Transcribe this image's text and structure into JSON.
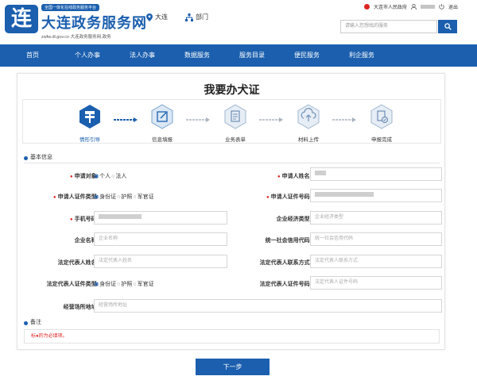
{
  "header": {
    "slogan": "全国一体化在线政务服务平台",
    "site_title": "大连政务服务网",
    "site_sub": "zwfw.dl.gov.cn  大连政务服务网.政务",
    "logo_char": "连",
    "location": "大连",
    "department": "部门",
    "gov_link": "大连市人民政府",
    "logout": "退出",
    "search_placeholder": "请输入您想找的服务"
  },
  "nav": {
    "items": [
      "首页",
      "个人办事",
      "法人办事",
      "数据服务",
      "服务目录",
      "便民服务",
      "利企服务"
    ]
  },
  "page": {
    "title": "我要办犬证",
    "steps": [
      {
        "label": "情形引导",
        "icon": "signpost-icon",
        "active": true
      },
      {
        "label": "信息填报",
        "icon": "form-edit-icon",
        "active": false
      },
      {
        "label": "业务表单",
        "icon": "document-icon",
        "active": false
      },
      {
        "label": "材料上传",
        "icon": "upload-icon",
        "active": false
      },
      {
        "label": "申报完成",
        "icon": "complete-icon",
        "active": false
      }
    ]
  },
  "basic_info": {
    "section_title": "基本信息",
    "applicant_type": {
      "label": "申请对象:",
      "options": [
        "个人",
        "法人"
      ],
      "selected": "个人"
    },
    "applicant_name": {
      "label": "申请人姓名:",
      "value": ""
    },
    "id_type": {
      "label": "申请人证件类型:",
      "options": [
        "身份证",
        "护照",
        "军官证"
      ],
      "selected": "身份证"
    },
    "id_number": {
      "label": "申请人证件号码:",
      "value": ""
    },
    "mobile": {
      "label": "手机号码:",
      "value": ""
    },
    "company_type": {
      "label": "企业经济类型:",
      "placeholder": "企业经济类型"
    },
    "company_name": {
      "label": "企业名称:",
      "placeholder": "企业名称"
    },
    "credit_code": {
      "label": "统一社会信用代码:",
      "placeholder": "统一社会信用代码"
    },
    "legal_rep_name": {
      "label": "法定代表人姓名:",
      "placeholder": "法定代表人姓名"
    },
    "legal_rep_contact": {
      "label": "法定代表人联系方式:",
      "placeholder": "法定代表人联系方式"
    },
    "legal_rep_id_type": {
      "label": "法定代表人证件类型:",
      "options": [
        "身份证",
        "护照",
        "军官证"
      ],
      "selected": "身份证"
    },
    "legal_rep_id_number": {
      "label": "法定代表人证件号码:",
      "placeholder": "法定代表人证件号码"
    },
    "business_address": {
      "label": "经营场所地址:",
      "placeholder": "经营场所地址"
    }
  },
  "remark": {
    "section_title": "备注",
    "note": "标●的为必填项。"
  },
  "actions": {
    "next": "下一步"
  },
  "colors": {
    "brand": "#1b5fae",
    "required": "#e02020"
  }
}
